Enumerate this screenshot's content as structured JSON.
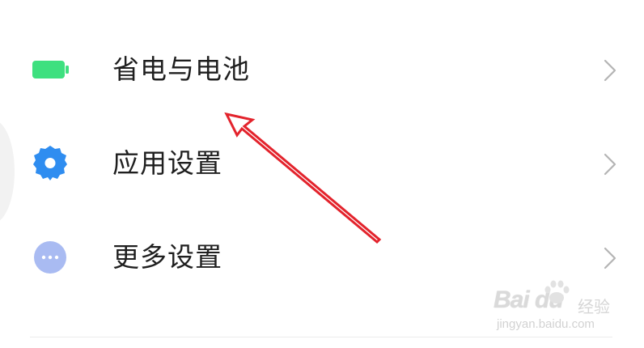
{
  "settings": {
    "items": [
      {
        "label": "省电与电池",
        "icon": "battery-icon",
        "color": "#3ee07f"
      },
      {
        "label": "应用设置",
        "icon": "gear-icon",
        "color": "#2f8df0"
      },
      {
        "label": "更多设置",
        "icon": "more-dots-icon",
        "color": "#a9bbf2"
      }
    ],
    "chevron": "chevron-right-icon"
  },
  "annotation": {
    "arrow_color": "#e3232c"
  },
  "watermark": {
    "brand": "Bai du",
    "sub": "经验",
    "url": "jingyan.baidu.com"
  }
}
